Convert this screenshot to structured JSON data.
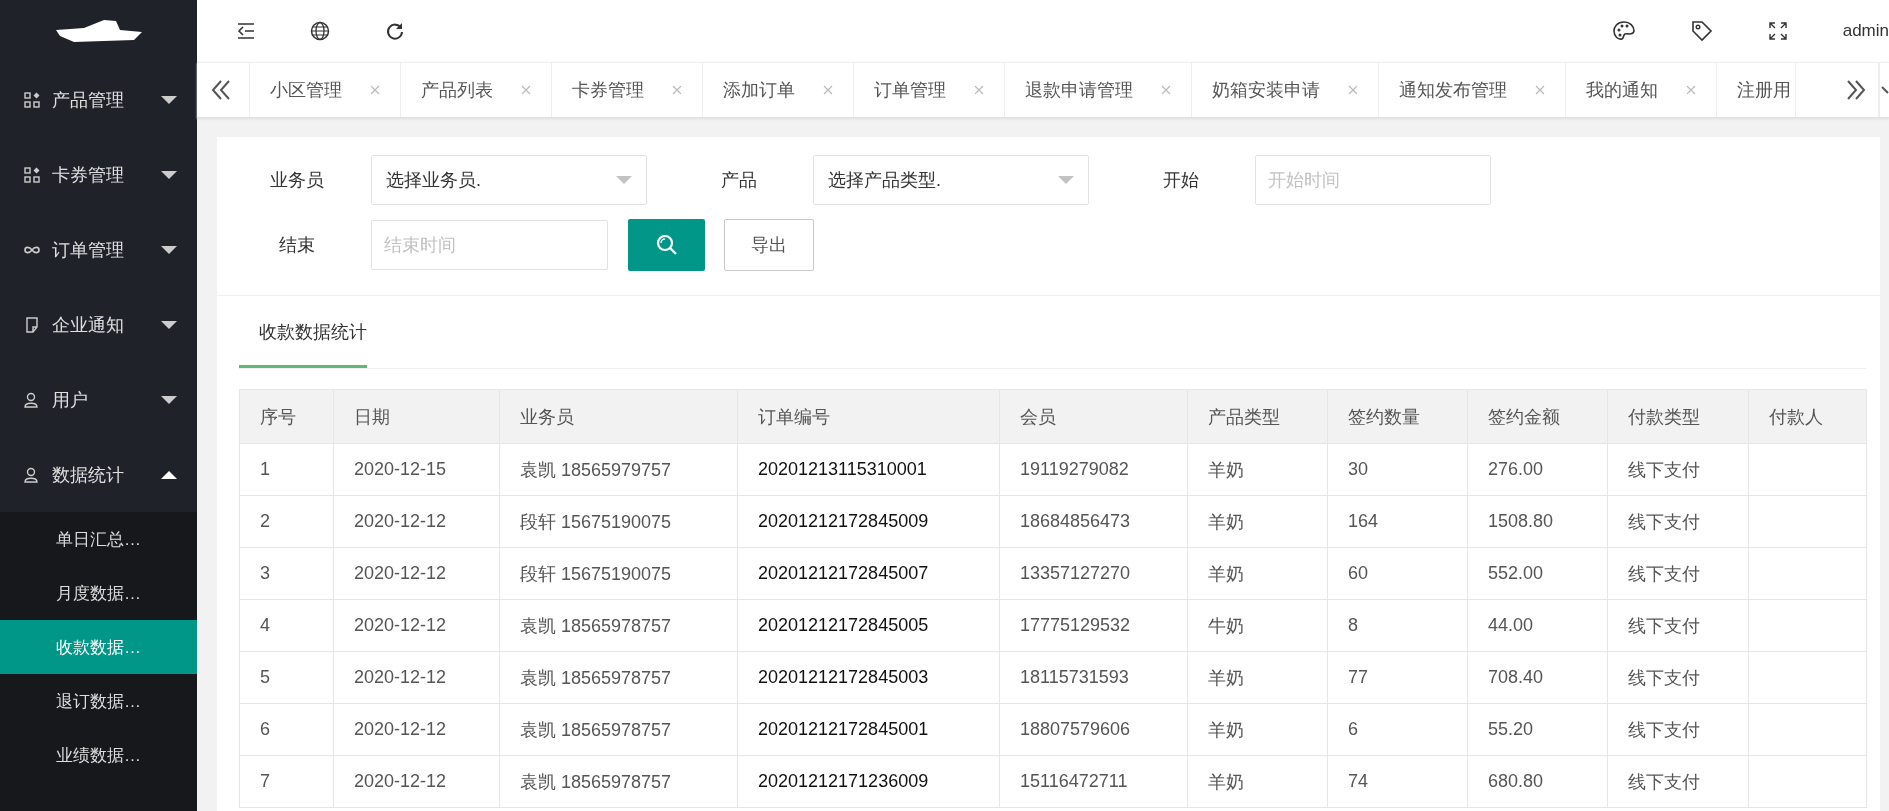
{
  "header": {
    "user": "admin"
  },
  "sidebar": {
    "items": [
      {
        "label": "产品管理",
        "kind": "grid",
        "expanded": false
      },
      {
        "label": "卡券管理",
        "kind": "grid",
        "expanded": false
      },
      {
        "label": "订单管理",
        "kind": "link",
        "expanded": false
      },
      {
        "label": "企业通知",
        "kind": "note",
        "expanded": false
      },
      {
        "label": "用户",
        "kind": "user",
        "expanded": false
      },
      {
        "label": "数据统计",
        "kind": "user",
        "expanded": true,
        "children": [
          {
            "label": "单日汇总…",
            "selected": false
          },
          {
            "label": "月度数据…",
            "selected": false
          },
          {
            "label": "收款数据…",
            "selected": true
          },
          {
            "label": "退订数据…",
            "selected": false
          },
          {
            "label": "业绩数据…",
            "selected": false
          }
        ]
      }
    ]
  },
  "tabs": [
    {
      "label": "小区管理"
    },
    {
      "label": "产品列表"
    },
    {
      "label": "卡券管理"
    },
    {
      "label": "添加订单"
    },
    {
      "label": "订单管理"
    },
    {
      "label": "退款申请管理"
    },
    {
      "label": "奶箱安装申请"
    },
    {
      "label": "通知发布管理"
    },
    {
      "label": "我的通知"
    },
    {
      "label": "注册用"
    }
  ],
  "filters": {
    "salesman_label": "业务员",
    "salesman_placeholder": "选择业务员.",
    "product_label": "产品",
    "product_placeholder": "选择产品类型.",
    "start_label": "开始",
    "start_placeholder": "开始时间",
    "end_label": "结束",
    "end_placeholder": "结束时间",
    "export_button": "导出"
  },
  "section_tab": "收款数据统计",
  "table": {
    "columns": [
      "序号",
      "日期",
      "业务员",
      "订单编号",
      "会员",
      "产品类型",
      "签约数量",
      "签约金额",
      "付款类型",
      "付款人"
    ],
    "rows": [
      [
        "1",
        "2020-12-15",
        "袁凯 18565979757",
        "20201213115310001",
        "19119279082",
        "羊奶",
        "30",
        "276.00",
        "线下支付",
        ""
      ],
      [
        "2",
        "2020-12-12",
        "段轩 15675190075",
        "20201212172845009",
        "18684856473",
        "羊奶",
        "164",
        "1508.80",
        "线下支付",
        ""
      ],
      [
        "3",
        "2020-12-12",
        "段轩 15675190075",
        "20201212172845007",
        "13357127270",
        "羊奶",
        "60",
        "552.00",
        "线下支付",
        ""
      ],
      [
        "4",
        "2020-12-12",
        "袁凯 18565978757",
        "20201212172845005",
        "17775129532",
        "牛奶",
        "8",
        "44.00",
        "线下支付",
        ""
      ],
      [
        "5",
        "2020-12-12",
        "袁凯 18565978757",
        "20201212172845003",
        "18115731593",
        "羊奶",
        "77",
        "708.40",
        "线下支付",
        ""
      ],
      [
        "6",
        "2020-12-12",
        "袁凯 18565978757",
        "20201212172845001",
        "18807579606",
        "羊奶",
        "6",
        "55.20",
        "线下支付",
        ""
      ],
      [
        "7",
        "2020-12-12",
        "袁凯 18565978757",
        "20201212171236009",
        "15116472711",
        "羊奶",
        "74",
        "680.80",
        "线下支付",
        ""
      ]
    ]
  }
}
